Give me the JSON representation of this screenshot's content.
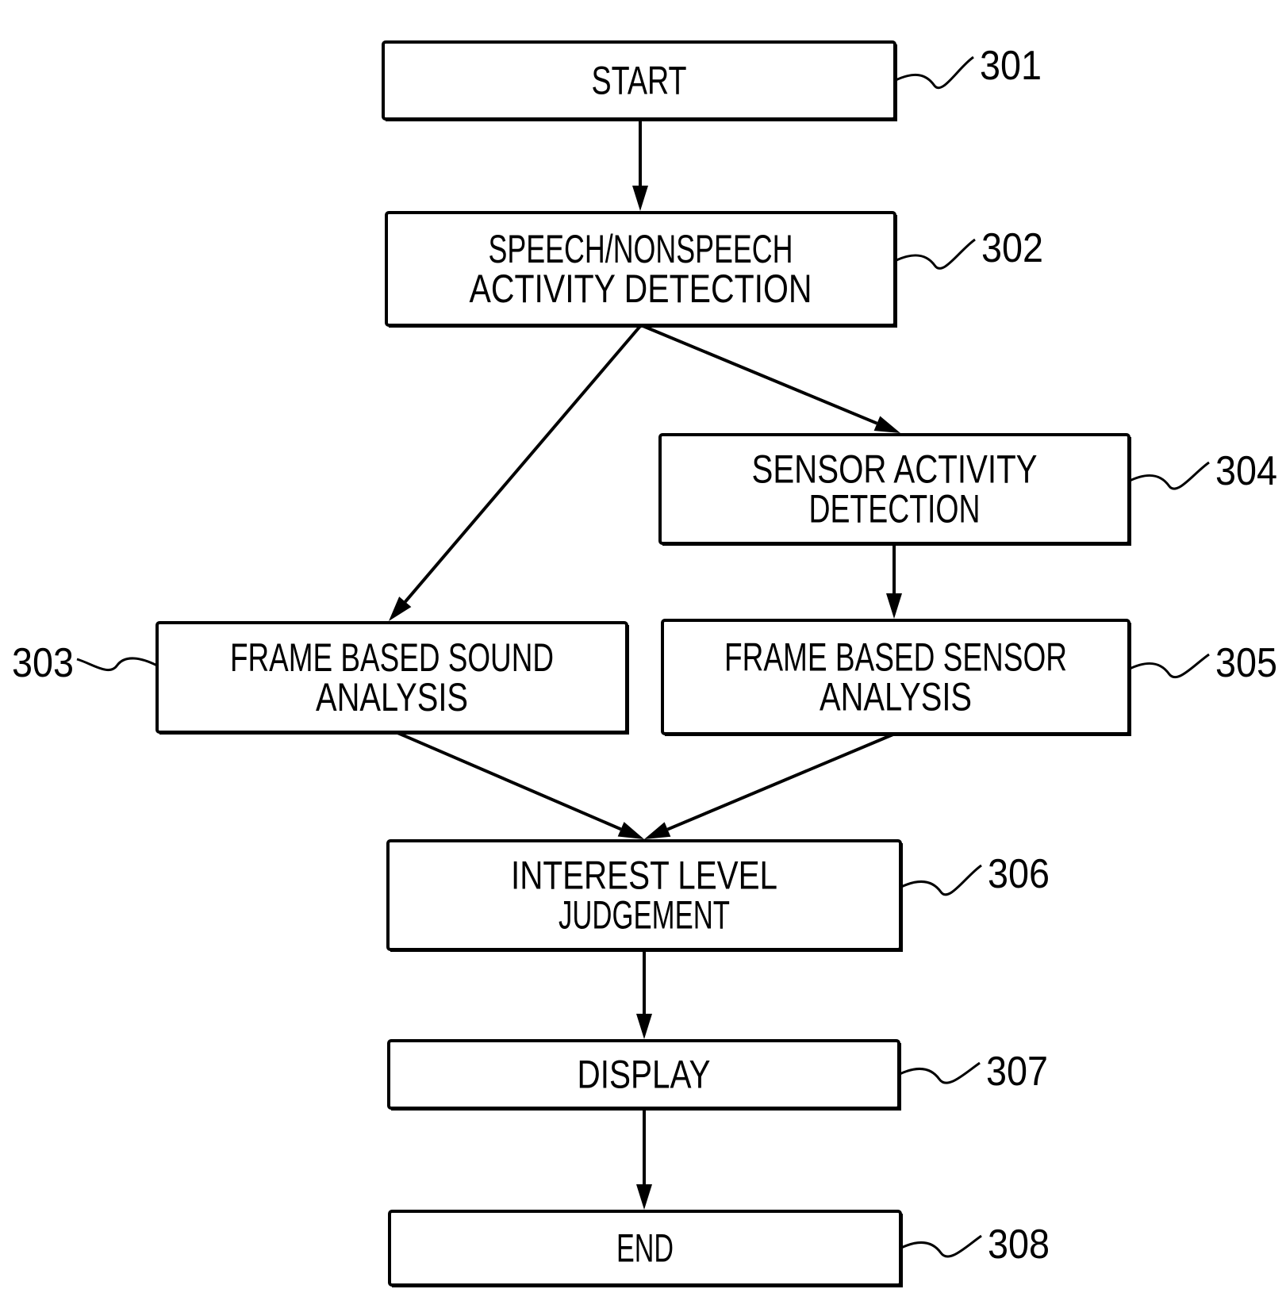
{
  "diagram": {
    "type": "flowchart",
    "nodes": [
      {
        "id": "301",
        "ref": "301",
        "lines": [
          "START"
        ]
      },
      {
        "id": "302",
        "ref": "302",
        "lines": [
          "SPEECH/NONSPEECH",
          "ACTIVITY DETECTION"
        ]
      },
      {
        "id": "303",
        "ref": "303",
        "lines": [
          "FRAME BASED SOUND",
          "ANALYSIS"
        ]
      },
      {
        "id": "304",
        "ref": "304",
        "lines": [
          "SENSOR ACTIVITY",
          "DETECTION"
        ]
      },
      {
        "id": "305",
        "ref": "305",
        "lines": [
          "FRAME BASED SENSOR",
          "ANALYSIS"
        ]
      },
      {
        "id": "306",
        "ref": "306",
        "lines": [
          "INTEREST LEVEL",
          "JUDGEMENT"
        ]
      },
      {
        "id": "307",
        "ref": "307",
        "lines": [
          "DISPLAY"
        ]
      },
      {
        "id": "308",
        "ref": "308",
        "lines": [
          "END"
        ]
      }
    ],
    "edges": [
      {
        "from": "301",
        "to": "302"
      },
      {
        "from": "302",
        "to": "303"
      },
      {
        "from": "302",
        "to": "304"
      },
      {
        "from": "304",
        "to": "305"
      },
      {
        "from": "303",
        "to": "306"
      },
      {
        "from": "305",
        "to": "306"
      },
      {
        "from": "306",
        "to": "307"
      },
      {
        "from": "307",
        "to": "308"
      }
    ]
  }
}
